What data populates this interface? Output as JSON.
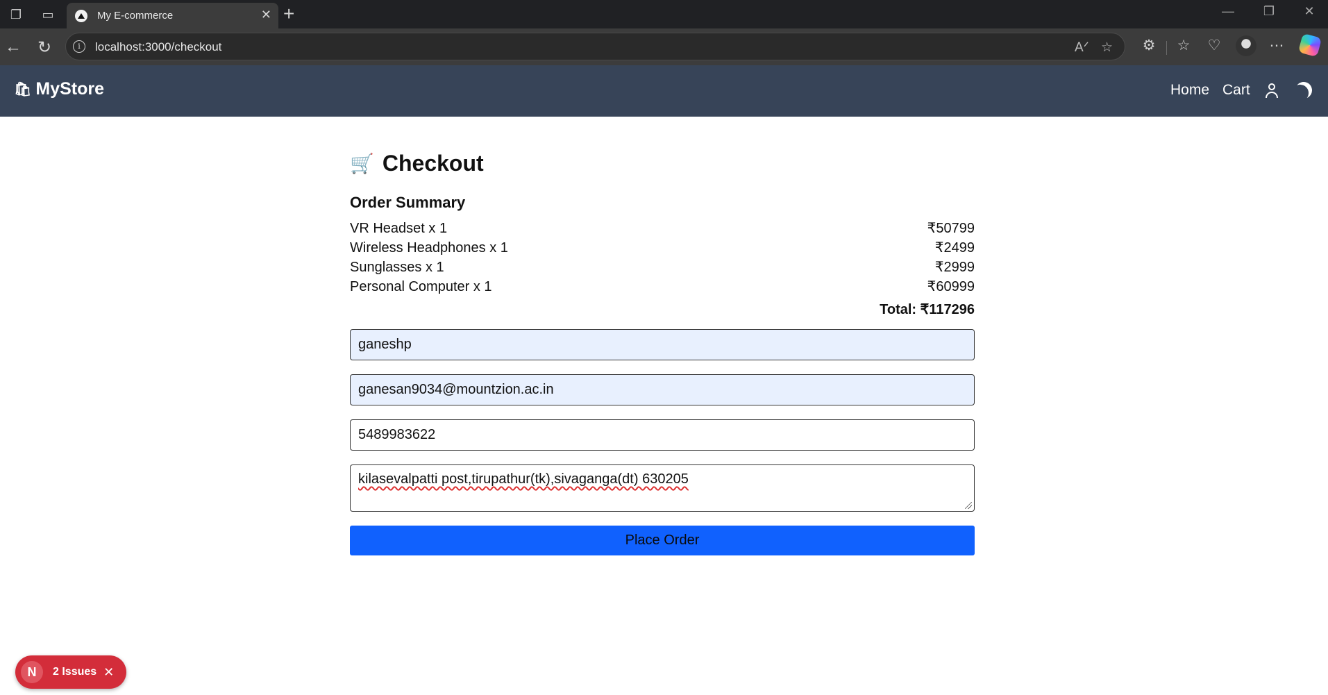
{
  "browser": {
    "tab_title": "My E-commerce",
    "url": "localhost:3000/checkout"
  },
  "header": {
    "brand": "MyStore",
    "brand_icon": "🛍",
    "nav": {
      "home": "Home",
      "cart": "Cart"
    }
  },
  "checkout": {
    "title_icon": "🛒",
    "title": "Checkout",
    "summary_title": "Order Summary",
    "items": [
      {
        "label": "VR Headset x 1",
        "price": "₹50799"
      },
      {
        "label": "Wireless Headphones x 1",
        "price": "₹2499"
      },
      {
        "label": "Sunglasses x 1",
        "price": "₹2999"
      },
      {
        "label": "Personal Computer x 1",
        "price": "₹60999"
      }
    ],
    "total": "Total: ₹117296",
    "form": {
      "name": "ganeshp",
      "email": "ganesan9034@mountzion.ac.in",
      "phone": "5489983622",
      "address": "kilasevalpatti post,tirupathur(tk),sivaganga(dt) 630205"
    },
    "submit_label": "Place Order"
  },
  "dev_overlay": {
    "badge_letter": "N",
    "issues_label": "2 Issues"
  },
  "colors": {
    "header_bg": "#374458",
    "button_bg": "#1061fe",
    "autofill_bg": "#e8f0fe",
    "issues_badge_bg": "#d32d3a"
  }
}
